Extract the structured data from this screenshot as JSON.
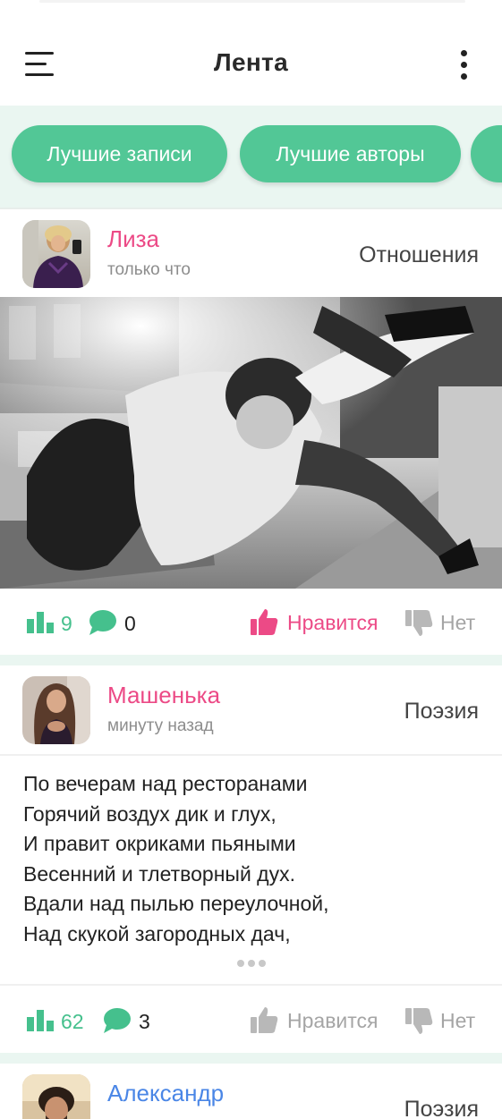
{
  "header": {
    "title": "Лента",
    "menu_icon": "hamburger-menu-icon",
    "more_icon": "more-vertical-icon"
  },
  "filters": {
    "chips": [
      {
        "label": "Лучшие записи"
      },
      {
        "label": "Лучшие авторы"
      },
      {
        "label": ""
      }
    ]
  },
  "colors": {
    "accent_green": "#52c796",
    "author_pink": "#ec4a86",
    "author_blue": "#4a86e6",
    "strip_bg": "#eaf6f1"
  },
  "posts": [
    {
      "author": "Лиза",
      "time": "только что",
      "category": "Отношения",
      "views": "9",
      "comments": "0",
      "like_label": "Нравится",
      "dislike_label": "Нет",
      "liked": true
    },
    {
      "author": "Машенька",
      "time": "минуту назад",
      "category": "Поэзия",
      "poem": [
        "По вечерам над ресторанами",
        "Горячий воздух дик и глух,",
        "И правит окриками пьяными",
        "Весенний и тлетворный дух.",
        "Вдали над пылью переулочной,",
        "Над скукой загородных дач,"
      ],
      "views": "62",
      "comments": "3",
      "like_label": "Нравится",
      "dislike_label": "Нет",
      "liked": false
    },
    {
      "author": "Александр",
      "category": "Поэзия"
    }
  ]
}
